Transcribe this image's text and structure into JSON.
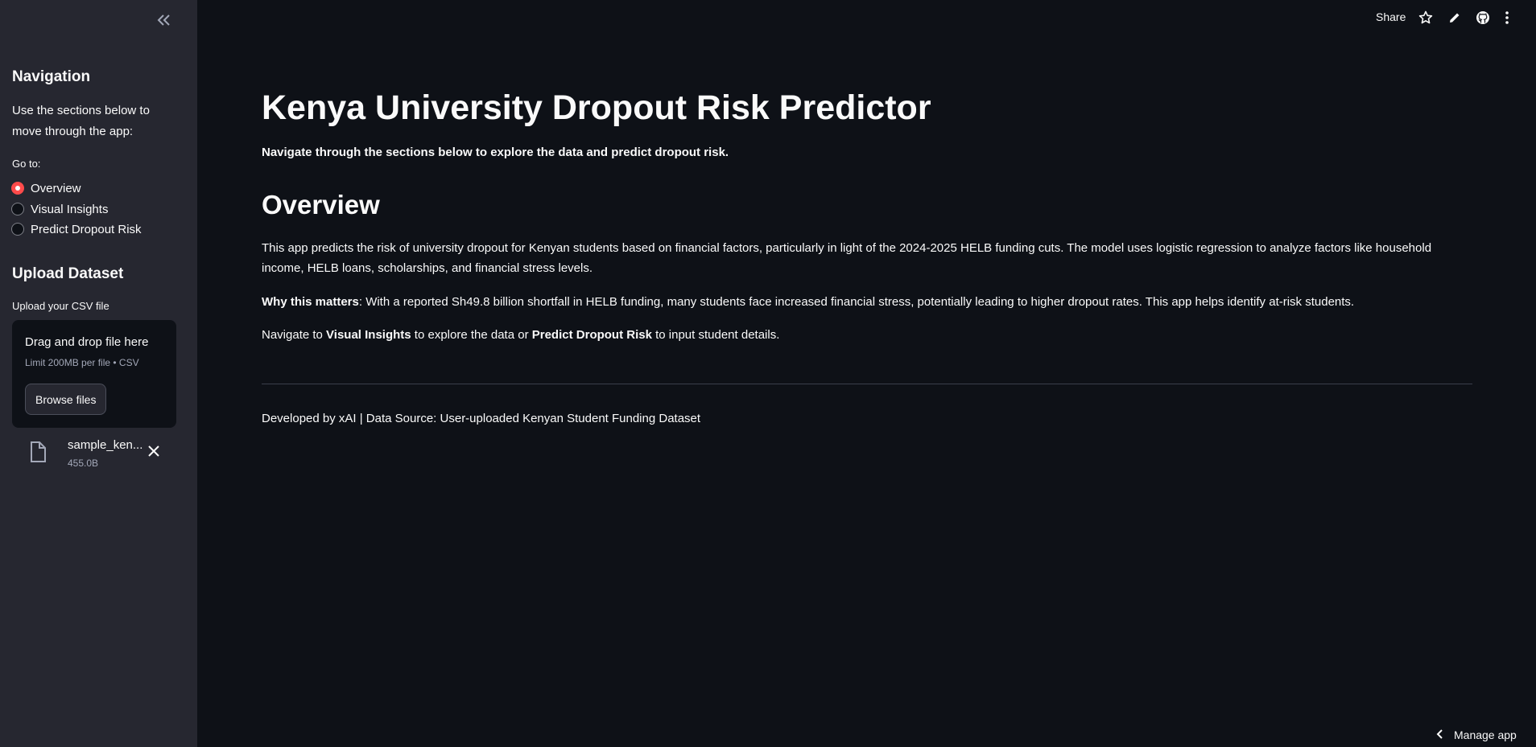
{
  "sidebar": {
    "navigation_heading": "Navigation",
    "navigation_text": "Use the sections below to move through the app:",
    "goto_label": "Go to:",
    "radio_options": [
      "Overview",
      "Visual Insights",
      "Predict Dropout Risk"
    ],
    "selected_option": "Overview",
    "upload_heading": "Upload Dataset",
    "upload_label": "Upload your CSV file",
    "dropzone_title": "Drag and drop file here",
    "dropzone_limit": "Limit 200MB per file • CSV",
    "browse_label": "Browse files",
    "file": {
      "name": "sample_ken...",
      "size": "455.0B"
    }
  },
  "topbar": {
    "share_label": "Share",
    "icons": [
      "star-icon",
      "edit-pencil-icon",
      "github-icon",
      "more-menu-icon"
    ]
  },
  "main": {
    "title": "Kenya University Dropout Risk Predictor",
    "subtitle": "Navigate through the sections below to explore the data and predict dropout risk.",
    "section_heading": "Overview",
    "paragraph1": "This app predicts the risk of university dropout for Kenyan students based on financial factors, particularly in light of the 2024-2025 HELB funding cuts. The model uses logistic regression to analyze factors like household income, HELB loans, scholarships, and financial stress levels.",
    "paragraph2_bold": "Why this matters",
    "paragraph2_rest": ": With a reported Sh49.8 billion shortfall in HELB funding, many students face increased financial stress, potentially leading to higher dropout rates. This app helps identify at-risk students.",
    "paragraph3_a": "Navigate to ",
    "paragraph3_b": "Visual Insights",
    "paragraph3_c": " to explore the data or ",
    "paragraph3_d": "Predict Dropout Risk",
    "paragraph3_e": " to input student details.",
    "footer": "Developed by xAI | Data Source: User-uploaded Kenyan Student Funding Dataset"
  },
  "manage_app_label": "Manage app",
  "colors": {
    "background": "#0e1117",
    "sidebar": "#262730",
    "accent": "#ff4b4b"
  }
}
